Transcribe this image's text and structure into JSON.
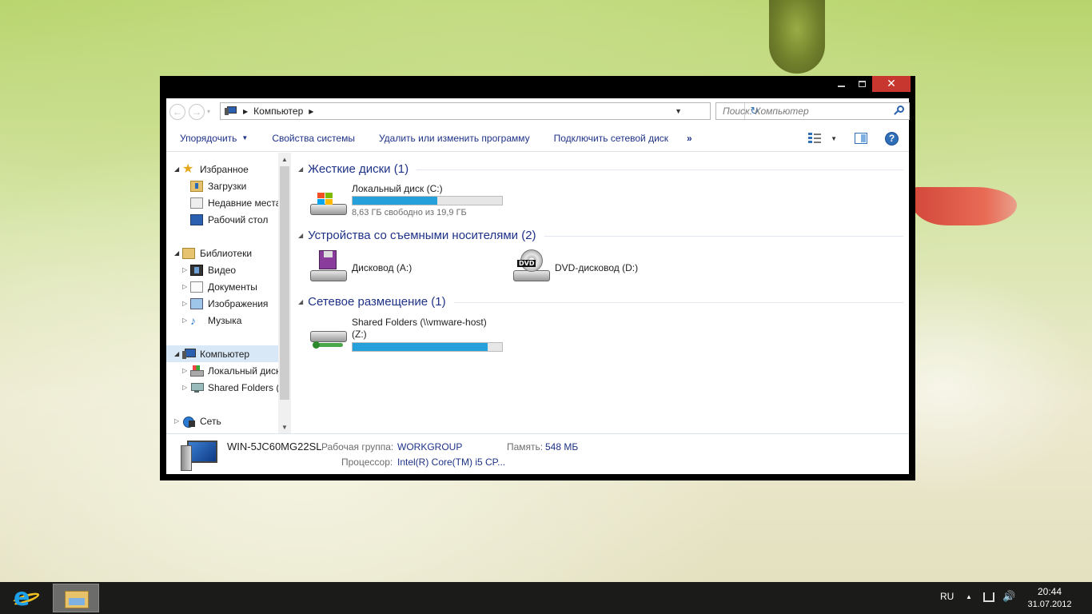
{
  "window": {
    "close_glyph": "✕"
  },
  "navigation": {
    "back_glyph": "←",
    "forward_glyph": "→",
    "recent_glyph": "▾"
  },
  "address_bar": {
    "crumbs": [
      "Компьютер"
    ],
    "arrow_glyph": "▶",
    "dropdown_glyph": "▼",
    "refresh_glyph": "↻"
  },
  "search": {
    "placeholder": "Поиск: Компьютер"
  },
  "toolbar": {
    "organize": "Упорядочить",
    "system_properties": "Свойства системы",
    "uninstall": "Удалить или изменить программу",
    "map_drive": "Подключить сетевой диск",
    "more": "»",
    "help": "?"
  },
  "tree": {
    "favorites": "Избранное",
    "downloads": "Загрузки",
    "recent": "Недавние места",
    "desktop": "Рабочий стол",
    "libraries": "Библиотеки",
    "videos": "Видео",
    "documents": "Документы",
    "pictures": "Изображения",
    "music": "Музыка",
    "computer": "Компьютер",
    "local_disk": "Локальный диск",
    "shared_folders": "Shared Folders (\\\\",
    "network": "Сеть"
  },
  "groups": {
    "hard_disks": "Жесткие диски (1)",
    "removable": "Устройства со съемными носителями (2)",
    "network_locations": "Сетевое размещение (1)"
  },
  "drives": {
    "c": {
      "name": "Локальный диск (C:)",
      "free_text": "8,63 ГБ свободно из 19,9 ГБ",
      "used_fraction": 0.566
    },
    "a": {
      "name": "Дисковод (A:)"
    },
    "d": {
      "name": "DVD-дисковод (D:)",
      "icon_label": "DVD"
    },
    "z": {
      "name": "Shared Folders (\\\\vmware-host) (Z:)",
      "used_fraction": 0.905
    }
  },
  "details": {
    "computer_name": "WIN-5JC60MG22SL",
    "workgroup_label": "Рабочая группа:",
    "workgroup_value": "WORKGROUP",
    "memory_label": "Память:",
    "memory_value": "548 МБ",
    "cpu_label": "Процессор:",
    "cpu_value": "Intel(R) Core(TM) i5 CP..."
  },
  "taskbar": {
    "language": "RU",
    "time": "20:44",
    "date": "31.07.2012",
    "speaker_glyph": "🔊"
  },
  "colors": {
    "accent": "#26a0da",
    "link_text": "#1e3287",
    "close_button": "#c7372f",
    "taskbar": "#1b1c1a"
  }
}
